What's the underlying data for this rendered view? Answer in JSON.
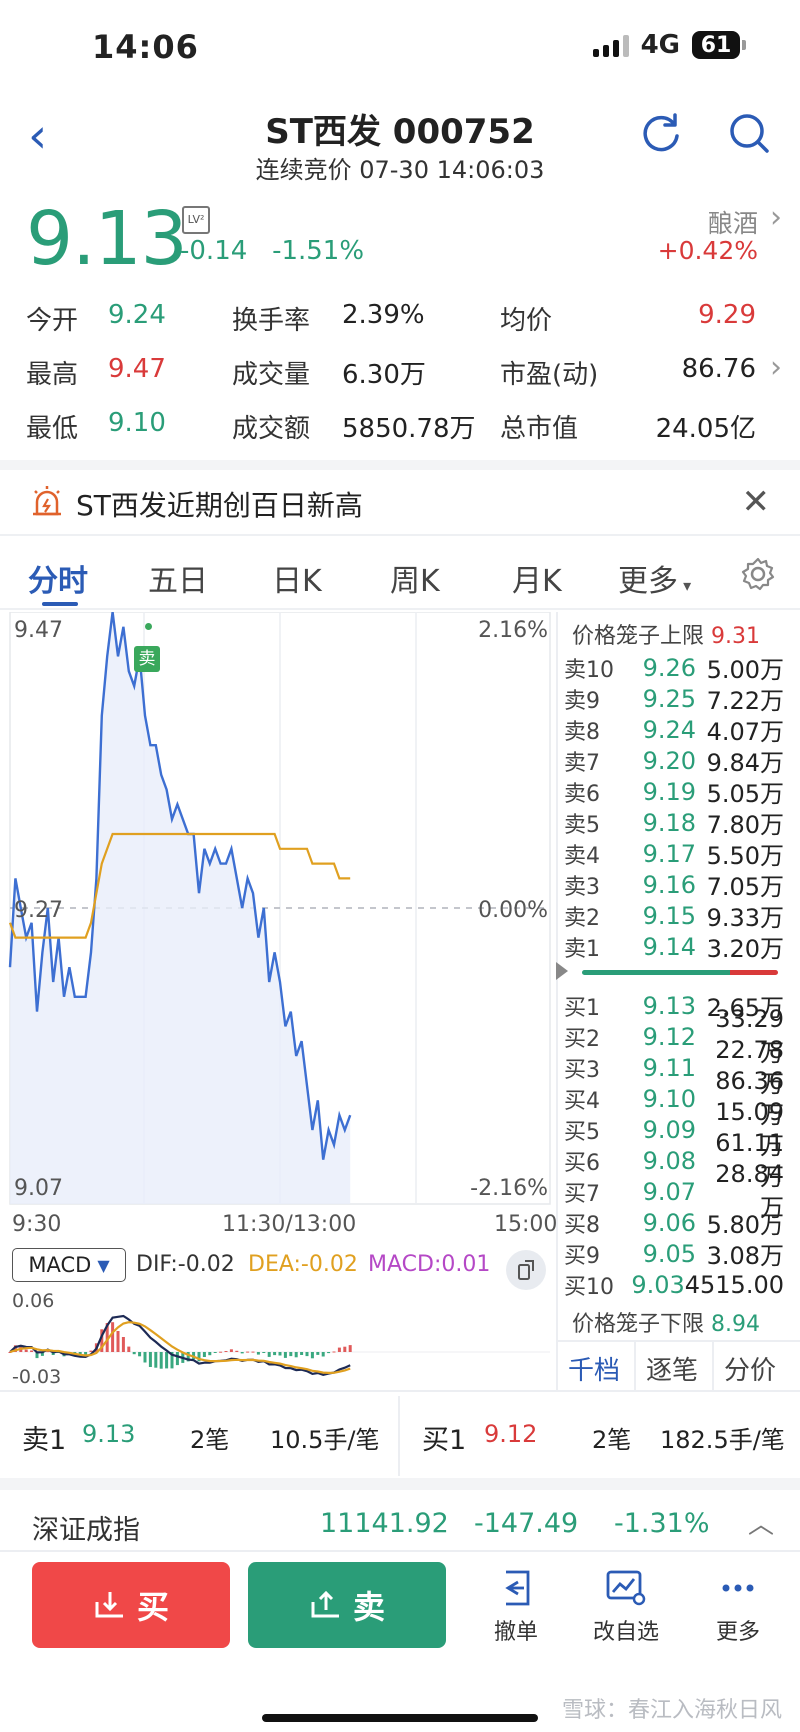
{
  "status": {
    "time": "14:06",
    "network": "4G",
    "battery": "61"
  },
  "header": {
    "title": "ST西发 000752",
    "subtitle": "连续竞价 07-30 14:06:03"
  },
  "quote": {
    "price": "9.13",
    "level": "LV²",
    "change": "-0.14",
    "change_pct": "-1.51%",
    "sector": "酿酒",
    "sector_change": "+0.42%"
  },
  "stats": {
    "open_label": "今开",
    "open": "9.24",
    "turnover_label": "换手率",
    "turnover": "2.39%",
    "avg_label": "均价",
    "avg": "9.29",
    "high_label": "最高",
    "high": "9.47",
    "volume_label": "成交量",
    "volume": "6.30万",
    "pe_label": "市盈(动)",
    "pe": "86.76",
    "low_label": "最低",
    "low": "9.10",
    "amount_label": "成交额",
    "amount": "5850.78万",
    "mcap_label": "总市值",
    "mcap": "24.05亿"
  },
  "banner": {
    "text": "ST西发近期创百日新高"
  },
  "tabs": [
    "分时",
    "五日",
    "日K",
    "周K",
    "月K",
    "更多"
  ],
  "chart": {
    "price_top": "9.47",
    "price_mid": "9.27",
    "price_bottom": "9.07",
    "pct_top": "2.16%",
    "pct_mid": "0.00%",
    "pct_bottom": "-2.16%",
    "time_start": "9:30",
    "time_mid": "11:30/13:00",
    "time_end": "15:00",
    "sell_marker": "卖",
    "macd_label": "MACD",
    "dif": "DIF:-0.02",
    "dea": "DEA:-0.02",
    "macd": "MACD:0.01",
    "macd_top": "0.06",
    "macd_bottom": "-0.03"
  },
  "chart_data": {
    "type": "line",
    "title": "",
    "series": [
      {
        "name": "",
        "values": [
          9.23,
          9.29,
          9.27,
          9.25,
          9.26,
          9.2,
          9.24,
          9.27,
          9.22,
          9.25,
          9.21,
          9.23,
          9.21,
          9.21,
          9.21,
          9.24,
          9.29,
          9.4,
          9.44,
          9.47,
          9.44,
          9.46,
          9.43,
          9.42,
          9.44,
          9.4,
          9.38,
          9.38,
          9.36,
          9.35,
          9.33,
          9.34,
          9.33,
          9.32,
          9.32,
          9.28,
          9.31,
          9.3,
          9.31,
          9.3,
          9.3,
          9.31,
          9.29,
          9.27,
          9.29,
          9.28,
          9.25,
          9.27,
          9.22,
          9.24,
          9.22,
          9.19,
          9.2,
          9.17,
          9.18,
          9.15,
          9.12,
          9.14,
          9.1,
          9.12,
          9.11,
          9.13,
          9.12,
          9.13
        ]
      },
      {
        "name": "",
        "values": [
          9.26,
          9.25,
          9.25,
          9.25,
          9.25,
          9.25,
          9.25,
          9.25,
          9.25,
          9.25,
          9.25,
          9.25,
          9.25,
          9.25,
          9.25,
          9.26,
          9.28,
          9.3,
          9.31,
          9.32,
          9.32,
          9.32,
          9.32,
          9.32,
          9.32,
          9.32,
          9.32,
          9.32,
          9.32,
          9.32,
          9.32,
          9.32,
          9.32,
          9.32,
          9.32,
          9.32,
          9.32,
          9.32,
          9.32,
          9.32,
          9.32,
          9.32,
          9.32,
          9.32,
          9.32,
          9.32,
          9.32,
          9.32,
          9.32,
          9.32,
          9.31,
          9.31,
          9.31,
          9.31,
          9.31,
          9.31,
          9.3,
          9.3,
          9.3,
          9.3,
          9.3,
          9.29,
          9.29,
          9.29
        ]
      }
    ],
    "ylim": [
      9.07,
      9.47
    ],
    "prev_close": 9.27,
    "xlabel": "",
    "ylabel": ""
  },
  "orderbook": {
    "upper_label": "价格笼子上限",
    "upper": "9.31",
    "lower_label": "价格笼子下限",
    "lower": "8.94",
    "asks": [
      {
        "label": "卖10",
        "price": "9.26",
        "vol": "5.00万"
      },
      {
        "label": "卖9",
        "price": "9.25",
        "vol": "7.22万"
      },
      {
        "label": "卖8",
        "price": "9.24",
        "vol": "4.07万"
      },
      {
        "label": "卖7",
        "price": "9.20",
        "vol": "9.84万"
      },
      {
        "label": "卖6",
        "price": "9.19",
        "vol": "5.05万"
      },
      {
        "label": "卖5",
        "price": "9.18",
        "vol": "7.80万"
      },
      {
        "label": "卖4",
        "price": "9.17",
        "vol": "5.50万"
      },
      {
        "label": "卖3",
        "price": "9.16",
        "vol": "7.05万"
      },
      {
        "label": "卖2",
        "price": "9.15",
        "vol": "9.33万"
      },
      {
        "label": "卖1",
        "price": "9.14",
        "vol": "3.20万"
      }
    ],
    "bids": [
      {
        "label": "买1",
        "price": "9.13",
        "vol": "2.65万"
      },
      {
        "label": "买2",
        "price": "9.12",
        "vol": "33.29万"
      },
      {
        "label": "买3",
        "price": "9.11",
        "vol": "22.78万"
      },
      {
        "label": "买4",
        "price": "9.10",
        "vol": "86.36万"
      },
      {
        "label": "买5",
        "price": "9.09",
        "vol": "15.09万"
      },
      {
        "label": "买6",
        "price": "9.08",
        "vol": "61.11万"
      },
      {
        "label": "买7",
        "price": "9.07",
        "vol": "28.84万"
      },
      {
        "label": "买8",
        "price": "9.06",
        "vol": "5.80万"
      },
      {
        "label": "买9",
        "price": "9.05",
        "vol": "3.08万"
      },
      {
        "label": "买10",
        "price": "9.03",
        "vol": "4515.00"
      }
    ],
    "tabs": [
      "千档",
      "逐笔",
      "分价"
    ]
  },
  "trades": {
    "sell_label": "卖1",
    "sell_price": "9.13",
    "sell_count": "2笔",
    "sell_avg": "10.5手/笔",
    "buy_label": "买1",
    "buy_price": "9.12",
    "buy_count": "2笔",
    "buy_avg": "182.5手/笔"
  },
  "index": {
    "name": "深证成指",
    "value": "11141.92",
    "change": "-147.49",
    "pct": "-1.31%"
  },
  "bottom": {
    "buy": "买",
    "sell": "卖",
    "cancel": "撤单",
    "watchlist": "改自选",
    "more": "更多"
  },
  "watermark": "雪球：春江入海秋日风",
  "colors": {
    "green": "#2a9d78",
    "red": "#d93a3a",
    "blue": "#2b5bb5",
    "avg_line": "#e0a020"
  }
}
